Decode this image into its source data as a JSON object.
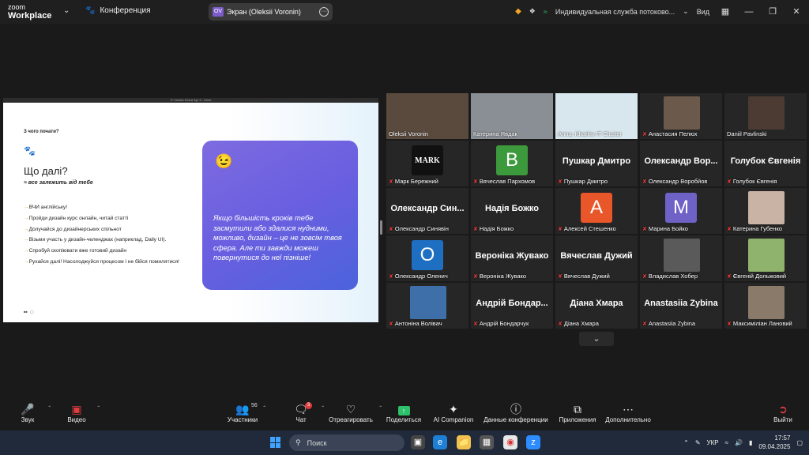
{
  "app": {
    "brand_line1": "zoom",
    "brand_line2": "Workplace"
  },
  "header": {
    "conference_label": "Конференция",
    "screen_pill": {
      "initials": "OV",
      "label": "Экран (Oleksii Voronin)"
    },
    "recording_label": "Индивидуальная служба потоково...",
    "view_label": "Вид"
  },
  "share": {
    "window_title": "IT Cluster Event Apr 9 - Deck",
    "slide": {
      "question": "З чого почати?",
      "heading": "Що далі?",
      "subheading": "≈ все залежить від тебе",
      "items": [
        "ВЧИ англійську!",
        "Пройди дизайн курс онлайн, читай статті",
        "Долучайся до дизайнерських спільнот",
        "Візьми участь у дизайн-челенджах (наприклад, Daily UI).",
        "Спробуй скопіювати вже готовий дизайн",
        "Рухайся далі! Насолоджуйся процесом і не бійся помилятися!"
      ],
      "card_text": "Якщо більшість кроків тебе засмутили або здалися нудними, можливо, дизайн – це не зовсім твоя сфера. Але ти завжди можеш повернутися до неї пізніше!"
    }
  },
  "participants": [
    {
      "name": "Oleksii Voronin",
      "kind": "video",
      "color": "#5a4a3e",
      "muted": false
    },
    {
      "name": "Катерина Явдак",
      "kind": "video",
      "color": "#8a8f96",
      "muted": false,
      "active": true
    },
    {
      "name": "Anna, Kharkiv IT Cluster",
      "kind": "video",
      "color": "#d8e6ee",
      "muted": false
    },
    {
      "name": "Анастасия Пелюх",
      "kind": "pic",
      "color": "#6b5a4c",
      "muted": true
    },
    {
      "name": "Daniil Pavlinski",
      "kind": "pic",
      "color": "#4b3b32",
      "muted": false
    },
    {
      "name": "Марк Бережний",
      "kind": "avatar",
      "letter": "MARK",
      "color": "#111111",
      "muted": true
    },
    {
      "name": "Вячеслав Пархомов",
      "kind": "avatar",
      "letter": "В",
      "color": "#3c9a3c",
      "muted": true
    },
    {
      "name": "Пушкар Дмитро",
      "kind": "text",
      "big": "Пушкар Дмитро",
      "muted": true
    },
    {
      "name": "Олександр Воробйов",
      "kind": "text",
      "big": "Олександр Вор...",
      "muted": true
    },
    {
      "name": "Голубок Євгенія",
      "kind": "text",
      "big": "Голубок Євгенія",
      "muted": true
    },
    {
      "name": "Олександр Синявін",
      "kind": "text",
      "big": "Олександр Син...",
      "muted": true
    },
    {
      "name": "Надія Божко",
      "kind": "text",
      "big": "Надія Божко",
      "muted": true
    },
    {
      "name": "Алексей Стешенко",
      "kind": "avatar",
      "letter": "А",
      "color": "#e8562a",
      "muted": true
    },
    {
      "name": "Марина Бойко",
      "kind": "avatar",
      "letter": "M",
      "color": "#6e62c7",
      "muted": true
    },
    {
      "name": "Катерина Губенко",
      "kind": "pic",
      "color": "#c9b3a5",
      "muted": true
    },
    {
      "name": "Олександр Оленич",
      "kind": "avatar",
      "letter": "O",
      "color": "#1e6fc2",
      "muted": true
    },
    {
      "name": "Вероніка Жувако",
      "kind": "text",
      "big": "Вероніка Жувако",
      "muted": true
    },
    {
      "name": "Вячеслав Дужий",
      "kind": "text",
      "big": "Вячеслав Дужий",
      "muted": true
    },
    {
      "name": "Владислав Хобер",
      "kind": "pic",
      "color": "#5a5a5a",
      "muted": true
    },
    {
      "name": "Євгеній Дольжовий",
      "kind": "pic",
      "color": "#8fb36c",
      "muted": true
    },
    {
      "name": "Антоніна Волівач",
      "kind": "pic",
      "color": "#3f6fa8",
      "muted": true
    },
    {
      "name": "Андрій Бондарчук",
      "kind": "text",
      "big": "Андрій Бондар...",
      "muted": true
    },
    {
      "name": "Діана Хмара",
      "kind": "text",
      "big": "Діана Хмара",
      "muted": true
    },
    {
      "name": "Anastasiia Zybina",
      "kind": "text",
      "big": "Anastasiia Zybina",
      "muted": true
    },
    {
      "name": "Максиміліан Лановий",
      "kind": "pic",
      "color": "#8a7a6a",
      "muted": true
    }
  ],
  "toolbar": {
    "audio": "Звук",
    "video": "Видео",
    "participants": "Участники",
    "participants_count": "56",
    "chat": "Чат",
    "chat_badge": "3",
    "react": "Отреагировать",
    "share": "Поделиться",
    "companion": "AI Companion",
    "info": "Данные конференции",
    "apps": "Приложения",
    "more": "Дополнительно",
    "leave": "Выйти"
  },
  "taskbar": {
    "search": "Поиск",
    "lang": "УКР",
    "time": "17:57",
    "date": "09.04.2025"
  }
}
